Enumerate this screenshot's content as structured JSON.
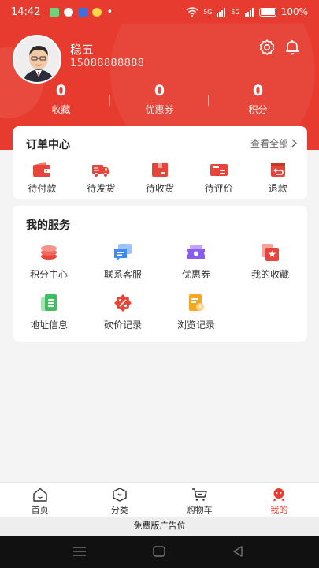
{
  "status_bar": {
    "time": "14:42",
    "dot": "•",
    "signal1": "5G",
    "signal2": "5G",
    "battery": "100%"
  },
  "profile": {
    "name": "稳五",
    "phone": "15088888888"
  },
  "stats": [
    {
      "value": "0",
      "label": "收藏"
    },
    {
      "value": "0",
      "label": "优惠券"
    },
    {
      "value": "0",
      "label": "积分"
    }
  ],
  "orders": {
    "title": "订单中心",
    "view_all": "查看全部",
    "items": [
      {
        "label": "待付款",
        "icon": "wallet-icon"
      },
      {
        "label": "待发货",
        "icon": "truck-icon"
      },
      {
        "label": "待收货",
        "icon": "package-icon"
      },
      {
        "label": "待评价",
        "icon": "review-icon"
      },
      {
        "label": "退款",
        "icon": "refund-icon"
      }
    ]
  },
  "services": {
    "title": "我的服务",
    "items": [
      {
        "label": "积分中心",
        "icon": "points-icon"
      },
      {
        "label": "联系客服",
        "icon": "customer-service-icon"
      },
      {
        "label": "优惠券",
        "icon": "coupon-icon"
      },
      {
        "label": "我的收藏",
        "icon": "favorites-icon"
      },
      {
        "label": "地址信息",
        "icon": "address-icon"
      },
      {
        "label": "砍价记录",
        "icon": "bargain-icon"
      },
      {
        "label": "浏览记录",
        "icon": "history-icon"
      }
    ]
  },
  "tabs": [
    {
      "label": "首页",
      "icon": "home-icon"
    },
    {
      "label": "分类",
      "icon": "category-icon"
    },
    {
      "label": "购物车",
      "icon": "cart-icon"
    },
    {
      "label": "我的",
      "icon": "profile-icon"
    }
  ],
  "active_tab": "我的",
  "ad_bar": "免费版广告位",
  "colors": {
    "brand": "#e63b2e",
    "service_blue": "#3d8cf5",
    "service_purple": "#8a5cf0",
    "service_green": "#3fbf5f",
    "service_orange": "#f5a623"
  }
}
